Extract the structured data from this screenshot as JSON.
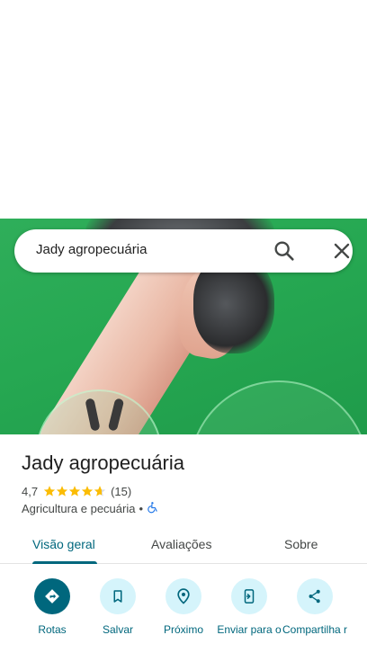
{
  "search": {
    "query": "Jady agropecuária"
  },
  "place": {
    "name": "Jady agropecuária",
    "rating": "4,7",
    "rating_value": 4.7,
    "review_count": "(15)",
    "category": "Agricultura e pecuária",
    "separator": "•"
  },
  "tabs": [
    {
      "label": "Visão geral",
      "active": true
    },
    {
      "label": "Avaliações",
      "active": false
    },
    {
      "label": "Sobre",
      "active": false
    }
  ],
  "actions": [
    {
      "label": "Rotas",
      "icon": "directions-icon"
    },
    {
      "label": "Salvar",
      "icon": "bookmark-icon"
    },
    {
      "label": "Próximo",
      "icon": "nearby-icon"
    },
    {
      "label": "Enviar para o",
      "icon": "send-to-phone-icon"
    },
    {
      "label": "Compartilha r",
      "icon": "share-icon"
    }
  ],
  "colors": {
    "accent": "#00677d",
    "action_bg": "#d5f4fb",
    "star": "#fbbc04",
    "accessibility": "#1a73e8"
  }
}
